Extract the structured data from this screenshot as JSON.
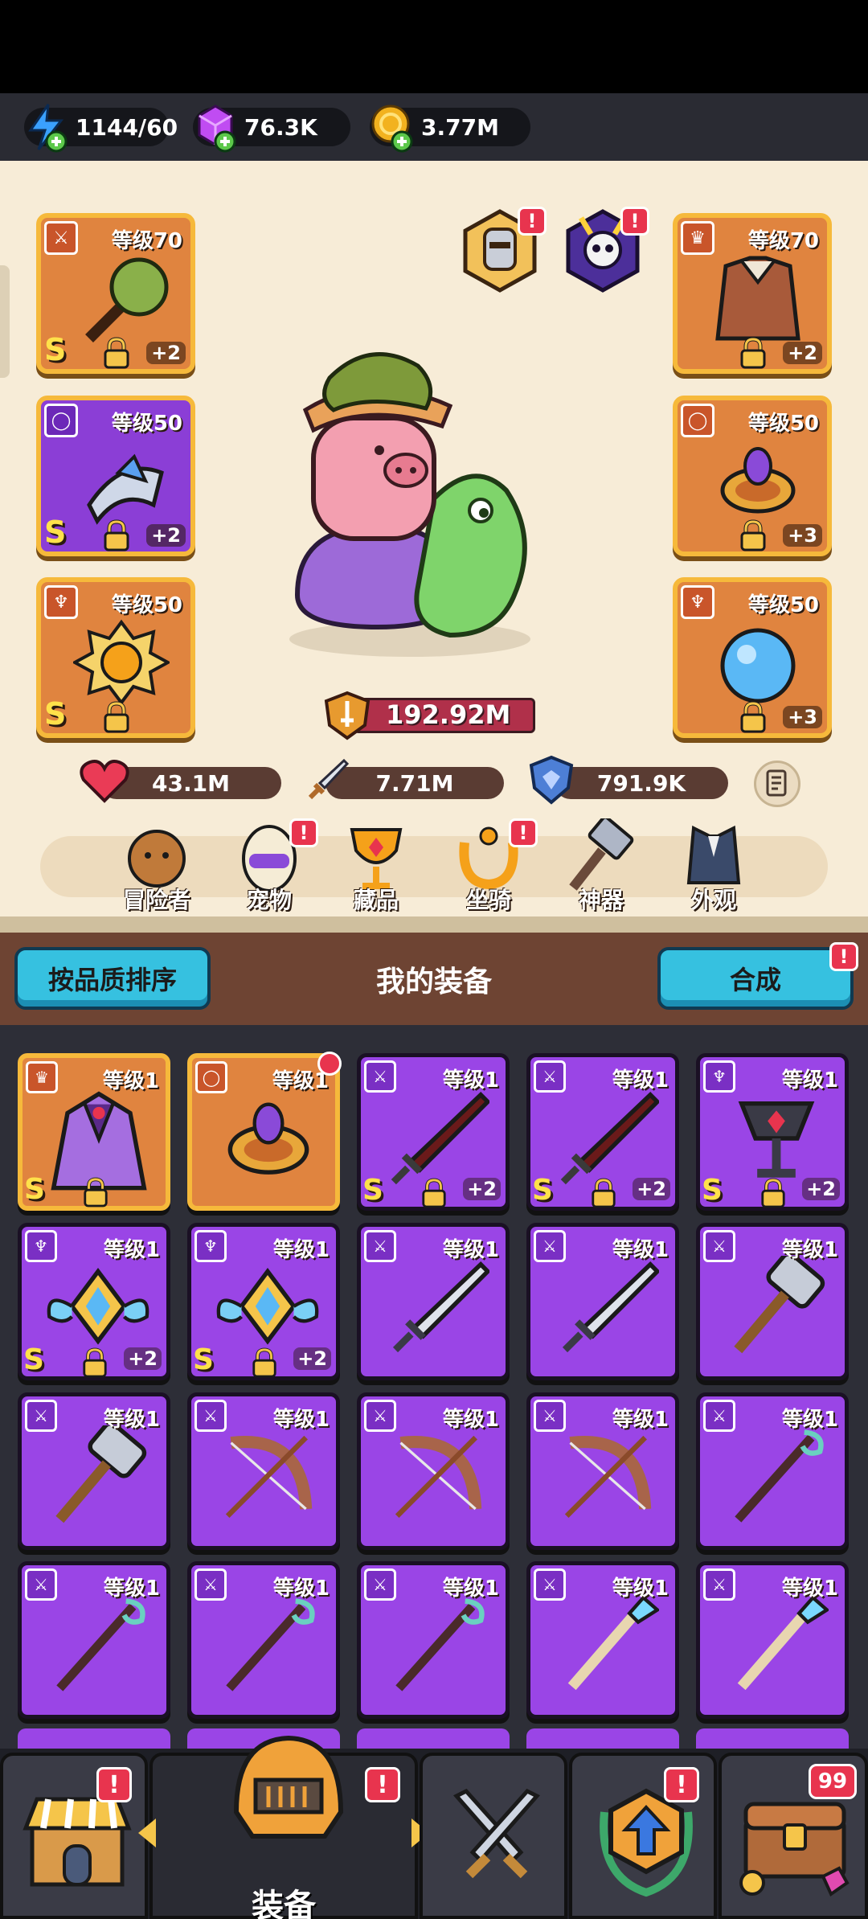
{
  "resources": [
    {
      "name": "energy",
      "value": "1144/60",
      "color": "#3aa0ff"
    },
    {
      "name": "gems",
      "value": "76.3K",
      "color": "#c04cf2"
    },
    {
      "name": "gold",
      "value": "3.77M",
      "color": "#f2b21f"
    }
  ],
  "hero_slots": {
    "left": [
      {
        "level": "等级70",
        "grade": "S",
        "plus": "+2",
        "icon": "sword-icon",
        "style": "orange",
        "art": "mace"
      },
      {
        "level": "等级50",
        "grade": "S",
        "plus": "+2",
        "icon": "ring-icon",
        "style": "purple",
        "art": "bracer"
      },
      {
        "level": "等级50",
        "grade": "S",
        "plus": "",
        "icon": "necklace-icon",
        "style": "orange",
        "art": "medal"
      }
    ],
    "right": [
      {
        "level": "等级70",
        "grade": "",
        "plus": "+2",
        "icon": "armor-icon",
        "style": "orange",
        "art": "armor"
      },
      {
        "level": "等级50",
        "grade": "",
        "plus": "+3",
        "icon": "ring-icon",
        "style": "orange",
        "art": "ring"
      },
      {
        "level": "等级50",
        "grade": "",
        "plus": "+3",
        "icon": "necklace-icon",
        "style": "orange",
        "art": "orb"
      }
    ]
  },
  "power": "192.92M",
  "stats": {
    "hp": "43.1M",
    "attack": "7.71M",
    "defense": "791.9K"
  },
  "nav": [
    {
      "label": "冒险者",
      "badge": false
    },
    {
      "label": "宠物",
      "badge": true
    },
    {
      "label": "藏品",
      "badge": false
    },
    {
      "label": "坐骑",
      "badge": true
    },
    {
      "label": "神器",
      "badge": false
    },
    {
      "label": "外观",
      "badge": false
    }
  ],
  "section": {
    "sort_label": "按品质排序",
    "title": "我的装备",
    "merge_label": "合成"
  },
  "inventory": [
    {
      "level": "等级1",
      "grade": "S",
      "plus": "",
      "style": "orange",
      "icon": "armor-icon",
      "art": "cape"
    },
    {
      "level": "等级1",
      "grade": "",
      "plus": "",
      "style": "orange",
      "icon": "ring-icon",
      "art": "ring"
    },
    {
      "level": "等级1",
      "grade": "S",
      "plus": "+2",
      "style": "purple",
      "icon": "sword-icon",
      "art": "darksword"
    },
    {
      "level": "等级1",
      "grade": "S",
      "plus": "+2",
      "style": "purple",
      "icon": "sword-icon",
      "art": "darksword"
    },
    {
      "level": "等级1",
      "grade": "S",
      "plus": "+2",
      "style": "purple",
      "icon": "necklace-icon",
      "art": "chalice"
    },
    {
      "level": "等级1",
      "grade": "S",
      "plus": "+2",
      "style": "purple",
      "icon": "necklace-icon",
      "art": "wings"
    },
    {
      "level": "等级1",
      "grade": "S",
      "plus": "+2",
      "style": "purple",
      "icon": "necklace-icon",
      "art": "wings"
    },
    {
      "level": "等级1",
      "grade": "",
      "plus": "",
      "style": "purple",
      "icon": "sword-icon",
      "art": "sword"
    },
    {
      "level": "等级1",
      "grade": "",
      "plus": "",
      "style": "purple",
      "icon": "sword-icon",
      "art": "sword"
    },
    {
      "level": "等级1",
      "grade": "",
      "plus": "",
      "style": "purple",
      "icon": "sword-icon",
      "art": "hammer"
    },
    {
      "level": "等级1",
      "grade": "",
      "plus": "",
      "style": "purple",
      "icon": "sword-icon",
      "art": "hammer"
    },
    {
      "level": "等级1",
      "grade": "",
      "plus": "",
      "style": "purple",
      "icon": "sword-icon",
      "art": "bow"
    },
    {
      "level": "等级1",
      "grade": "",
      "plus": "",
      "style": "purple",
      "icon": "sword-icon",
      "art": "bow"
    },
    {
      "level": "等级1",
      "grade": "",
      "plus": "",
      "style": "purple",
      "icon": "sword-icon",
      "art": "bow"
    },
    {
      "level": "等级1",
      "grade": "",
      "plus": "",
      "style": "purple",
      "icon": "sword-icon",
      "art": "staff"
    },
    {
      "level": "等级1",
      "grade": "",
      "plus": "",
      "style": "purple",
      "icon": "sword-icon",
      "art": "staff"
    },
    {
      "level": "等级1",
      "grade": "",
      "plus": "",
      "style": "purple",
      "icon": "sword-icon",
      "art": "staff"
    },
    {
      "level": "等级1",
      "grade": "",
      "plus": "",
      "style": "purple",
      "icon": "sword-icon",
      "art": "staff"
    },
    {
      "level": "等级1",
      "grade": "",
      "plus": "",
      "style": "purple",
      "icon": "sword-icon",
      "art": "icestaff"
    },
    {
      "level": "等级1",
      "grade": "",
      "plus": "",
      "style": "purple",
      "icon": "sword-icon",
      "art": "icestaff"
    }
  ],
  "bottom_nav": {
    "active_label": "装备",
    "chest_count": "99"
  }
}
